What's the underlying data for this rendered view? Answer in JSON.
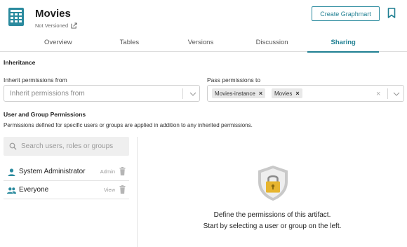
{
  "header": {
    "title": "Movies",
    "version_status": "Not Versioned",
    "create_button": "Create Graphmart"
  },
  "tabs": [
    {
      "label": "Overview",
      "active": false
    },
    {
      "label": "Tables",
      "active": false
    },
    {
      "label": "Versions",
      "active": false
    },
    {
      "label": "Discussion",
      "active": false
    },
    {
      "label": "Sharing",
      "active": true
    }
  ],
  "inheritance": {
    "section_title": "Inheritance",
    "inherit_label": "Inherit permissions from",
    "inherit_placeholder": "Inherit permissions from",
    "pass_label": "Pass permissions to",
    "pass_chips": [
      "Movies-instance",
      "Movies"
    ]
  },
  "permissions": {
    "section_title": "User and Group Permissions",
    "description": "Permissions defined for specific users or groups are applied in addition to any inherited permissions.",
    "search_placeholder": "Search users, roles or groups",
    "entries": [
      {
        "name": "System Administrator",
        "role": "Admin",
        "icon": "person-icon"
      },
      {
        "name": "Everyone",
        "role": "View",
        "icon": "group-icon"
      }
    ],
    "empty_line1": "Define the permissions of this artifact.",
    "empty_line2": "Start by selecting a user or group on the left."
  },
  "colors": {
    "accent": "#1f7f92",
    "icon_teal": "#2a8a9e",
    "shield_gold": "#e7b52f"
  }
}
